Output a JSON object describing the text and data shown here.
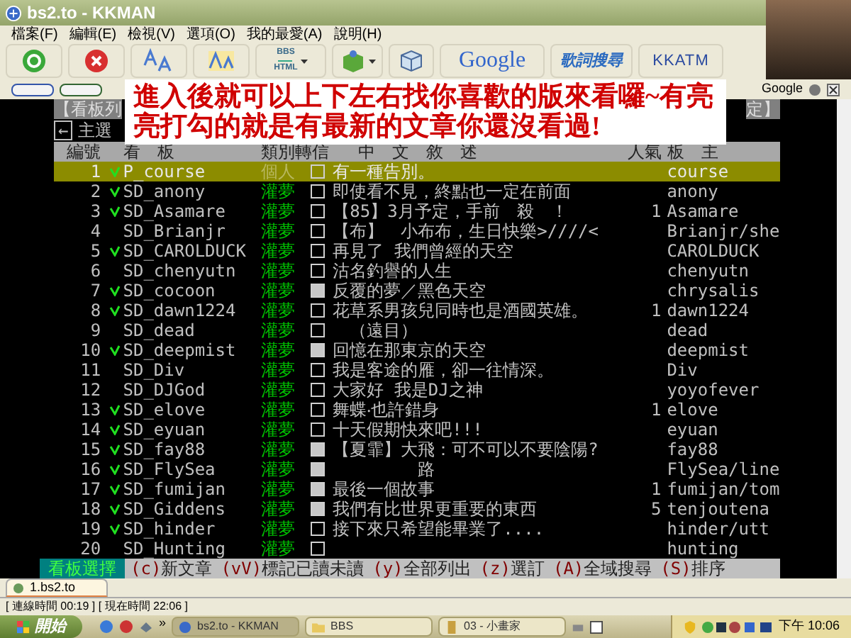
{
  "window": {
    "title": "bs2.to - KKMAN"
  },
  "menu": [
    "檔案(F)",
    "編輯(E)",
    "檢視(V)",
    "選項(O)",
    "我的最愛(A)",
    "說明(H)"
  ],
  "toolbar": [
    {
      "kind": "go"
    },
    {
      "kind": "stop"
    },
    {
      "kind": "font-large"
    },
    {
      "kind": "font-small"
    },
    {
      "kind": "bbs",
      "label": "BBS",
      "sublabel": "HTML",
      "dropdown": true
    },
    {
      "kind": "package",
      "dropdown": true
    },
    {
      "kind": "cube",
      "dropdown": false
    },
    {
      "kind": "google",
      "label": "Google"
    },
    {
      "kind": "lyrics",
      "label": "歌詞搜尋"
    },
    {
      "kind": "kkatm",
      "label": "KKATM"
    }
  ],
  "links_bar": {
    "search_label": "Google"
  },
  "annotation": "進入後就可以上下左右找你喜歡的版來看囉~有亮亮打勾的就是有最新的文章你還沒看過!",
  "terminal": {
    "heading_left": "【看板列",
    "heading_right": "定】",
    "back_key": "←",
    "back_label": "主選",
    "columns": [
      "編號",
      "看　板",
      "類別轉信",
      "中　文　敘　述",
      "人氣",
      "板　主"
    ],
    "rows": [
      {
        "number": "1",
        "unread": true,
        "board": "P_course",
        "category": "個人",
        "marked": false,
        "title": "有一種告別。",
        "moderator": "course",
        "selected": true
      },
      {
        "number": "2",
        "unread": true,
        "board": "SD_anony",
        "category": "灌夢",
        "marked": false,
        "title": "即使看不見，終點也一定在前面",
        "moderator": "anony",
        "selected": false
      },
      {
        "number": "3",
        "unread": true,
        "board": "SD_Asamare",
        "category": "灌夢",
        "marked": false,
        "title": "【85】3月予定，手前　殺　！",
        "popularity": "1",
        "moderator": "Asamare",
        "selected": false
      },
      {
        "number": "4",
        "unread": false,
        "board": "SD_Brianjr",
        "category": "灌夢",
        "marked": false,
        "title": "【布】　小布布，生日快樂>////<",
        "moderator": "Brianjr/she",
        "selected": false
      },
      {
        "number": "5",
        "unread": true,
        "board": "SD_CAROLDUCK",
        "category": "灌夢",
        "marked": false,
        "title": "再見了 我們曾經的天空",
        "moderator": "CAROLDUCK",
        "selected": false
      },
      {
        "number": "6",
        "unread": false,
        "board": "SD_chenyutn",
        "category": "灌夢",
        "marked": false,
        "title": "沽名釣譽的人生",
        "moderator": "chenyutn",
        "selected": false
      },
      {
        "number": "7",
        "unread": true,
        "board": "SD_cocoon",
        "category": "灌夢",
        "marked": true,
        "title": "反覆的夢／黑色天空",
        "moderator": "chrysalis",
        "selected": false
      },
      {
        "number": "8",
        "unread": true,
        "board": "SD_dawn1224",
        "category": "灌夢",
        "marked": false,
        "title": "花草系男孩兒同時也是酒國英雄。",
        "popularity": "1",
        "moderator": "dawn1224",
        "selected": false
      },
      {
        "number": "9",
        "unread": false,
        "board": "SD_dead",
        "category": "灌夢",
        "marked": false,
        "title": "　（遠目）",
        "moderator": "dead",
        "selected": false
      },
      {
        "number": "10",
        "unread": true,
        "board": "SD_deepmist",
        "category": "灌夢",
        "marked": true,
        "title": "回憶在那東京的天空",
        "moderator": "deepmist",
        "selected": false
      },
      {
        "number": "11",
        "unread": false,
        "board": "SD_Div",
        "category": "灌夢",
        "marked": false,
        "title": "我是客途的雁，卻一往情深。",
        "moderator": "Div",
        "selected": false
      },
      {
        "number": "12",
        "unread": false,
        "board": "SD_DJGod",
        "category": "灌夢",
        "marked": false,
        "title": "大家好 我是DJ之神",
        "moderator": "yoyofever",
        "selected": false
      },
      {
        "number": "13",
        "unread": true,
        "board": "SD_elove",
        "category": "灌夢",
        "marked": false,
        "title": "舞蝶‧也許錯身",
        "popularity": "1",
        "moderator": "elove",
        "selected": false
      },
      {
        "number": "14",
        "unread": true,
        "board": "SD_eyuan",
        "category": "灌夢",
        "marked": false,
        "title": "十天假期快來吧!!!",
        "moderator": "eyuan",
        "selected": false
      },
      {
        "number": "15",
        "unread": true,
        "board": "SD_fay88",
        "category": "灌夢",
        "marked": true,
        "title": "【夏霏】大飛：可不可以不要陰陽?",
        "moderator": "fay88",
        "selected": false
      },
      {
        "number": "16",
        "unread": true,
        "board": "SD_FlySea",
        "category": "灌夢",
        "marked": true,
        "title": "　　　　　路",
        "moderator": "FlySea/line",
        "selected": false
      },
      {
        "number": "17",
        "unread": true,
        "board": "SD_fumijan",
        "category": "灌夢",
        "marked": true,
        "title": "最後一個故事",
        "popularity": "1",
        "moderator": "fumijan/tom",
        "selected": false
      },
      {
        "number": "18",
        "unread": true,
        "board": "SD_Giddens",
        "category": "灌夢",
        "marked": true,
        "title": "我們有比世界更重要的東西",
        "popularity": "5",
        "moderator": "tenjoutena",
        "selected": false
      },
      {
        "number": "19",
        "unread": true,
        "board": "SD_hinder",
        "category": "灌夢",
        "marked": false,
        "title": "接下來只希望能畢業了....",
        "moderator": "hinder/utt",
        "selected": false
      },
      {
        "number": "20",
        "unread": false,
        "board": "SD_Hunting",
        "category": "灌夢",
        "marked": false,
        "moderator": "hunting",
        "selected": false
      }
    ],
    "command_bar": {
      "title": "看板選擇",
      "commands": [
        {
          "key": "(c)",
          "label": "新文章"
        },
        {
          "key": "(vV)",
          "label": "標記已讀未讀"
        },
        {
          "key": "(y)",
          "label": "全部列出"
        },
        {
          "key": "(z)",
          "label": "選訂"
        },
        {
          "key": "(A)",
          "label": "全域搜尋"
        },
        {
          "key": "(S)",
          "label": "排序"
        }
      ]
    }
  },
  "tabs": [
    {
      "label": "1.bs2.to",
      "selected": true
    }
  ],
  "status_bar": "[ 連線時間 00:19 ] [ 現在時間 22:06 ]",
  "taskbar": {
    "start": "開始",
    "overflow": "»",
    "tasks": [
      {
        "kind": "browser",
        "label": "bs2.to - KKMAN",
        "selected": true
      },
      {
        "kind": "folder",
        "label": "BBS",
        "selected": false
      },
      {
        "kind": "paint",
        "label": "03 - 小畫家",
        "selected": false
      }
    ],
    "clock": "下午 10:06"
  }
}
